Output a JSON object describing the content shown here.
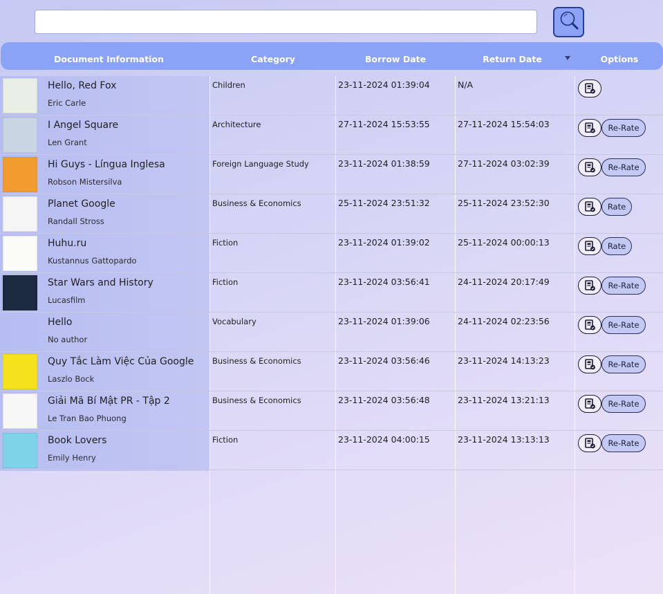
{
  "search": {
    "value": "",
    "placeholder": ""
  },
  "header": {
    "document_information": "Document Information",
    "category": "Category",
    "borrow_date": "Borrow Date",
    "return_date": "Return Date",
    "options": "Options"
  },
  "rows": [
    {
      "title": "Hello, Red Fox",
      "author": "Eric Carle",
      "category": "Children",
      "borrow_date": "23-11-2024 01:39:04",
      "return_date": "N/A",
      "rate_label": "",
      "cover_color": "#e9efe6"
    },
    {
      "title": "I Angel Square",
      "author": "Len Grant",
      "category": "Architecture",
      "borrow_date": "27-11-2024 15:53:55",
      "return_date": "27-11-2024 15:54:03",
      "rate_label": "Re-Rate",
      "cover_color": "#c8d5e3"
    },
    {
      "title": "Hi Guys - Língua Inglesa",
      "author": "Robson Mistersilva",
      "category": "Foreign Language Study",
      "borrow_date": "23-11-2024 01:38:59",
      "return_date": "27-11-2024 03:02:39",
      "rate_label": "Re-Rate",
      "cover_color": "#f29b2e"
    },
    {
      "title": "Planet Google",
      "author": "Randall Stross",
      "category": "Business & Economics",
      "borrow_date": "25-11-2024 23:51:32",
      "return_date": "25-11-2024 23:52:30",
      "rate_label": "Rate",
      "cover_color": "#f5f5f5"
    },
    {
      "title": "Huhu.ru",
      "author": "Kustannus Gattopardo",
      "category": "Fiction",
      "borrow_date": "23-11-2024 01:39:02",
      "return_date": "25-11-2024 00:00:13",
      "rate_label": "Rate",
      "cover_color": "#fbfbf7"
    },
    {
      "title": "Star Wars and History",
      "author": "Lucasfilm",
      "category": "Fiction",
      "borrow_date": "23-11-2024 03:56:41",
      "return_date": "24-11-2024 20:17:49",
      "rate_label": "Re-Rate",
      "cover_color": "#1b2a40"
    },
    {
      "title": "Hello",
      "author": "No author",
      "category": "Vocabulary",
      "borrow_date": "23-11-2024 01:39:06",
      "return_date": "24-11-2024 02:23:56",
      "rate_label": "Re-Rate",
      "cover_color": ""
    },
    {
      "title": "Quy Tắc Làm Việc Của Google",
      "author": "Laszlo Bock",
      "category": "Business & Economics",
      "borrow_date": "23-11-2024 03:56:46",
      "return_date": "23-11-2024 14:13:23",
      "rate_label": "Re-Rate",
      "cover_color": "#f6e21c"
    },
    {
      "title": "Giải Mã Bí Mật PR - Tập 2",
      "author": "Le Tran Bao Phuong",
      "category": "Business & Economics",
      "borrow_date": "23-11-2024 03:56:48",
      "return_date": "23-11-2024 13:21:13",
      "rate_label": "Re-Rate",
      "cover_color": "#f7f7f7"
    },
    {
      "title": "Book Lovers",
      "author": "Emily Henry",
      "category": "Fiction",
      "borrow_date": "23-11-2024 04:00:15",
      "return_date": "23-11-2024 13:13:13",
      "rate_label": "Re-Rate",
      "cover_color": "#7fd3e8"
    }
  ],
  "icons": {
    "search": "magnifier-icon",
    "detail": "document-edit-icon",
    "sort": "sort-down-arrow-icon"
  },
  "colors": {
    "header": "#8aa3f7",
    "search_button": "#8ba2f5",
    "rate_button": "#c3c9f2"
  }
}
